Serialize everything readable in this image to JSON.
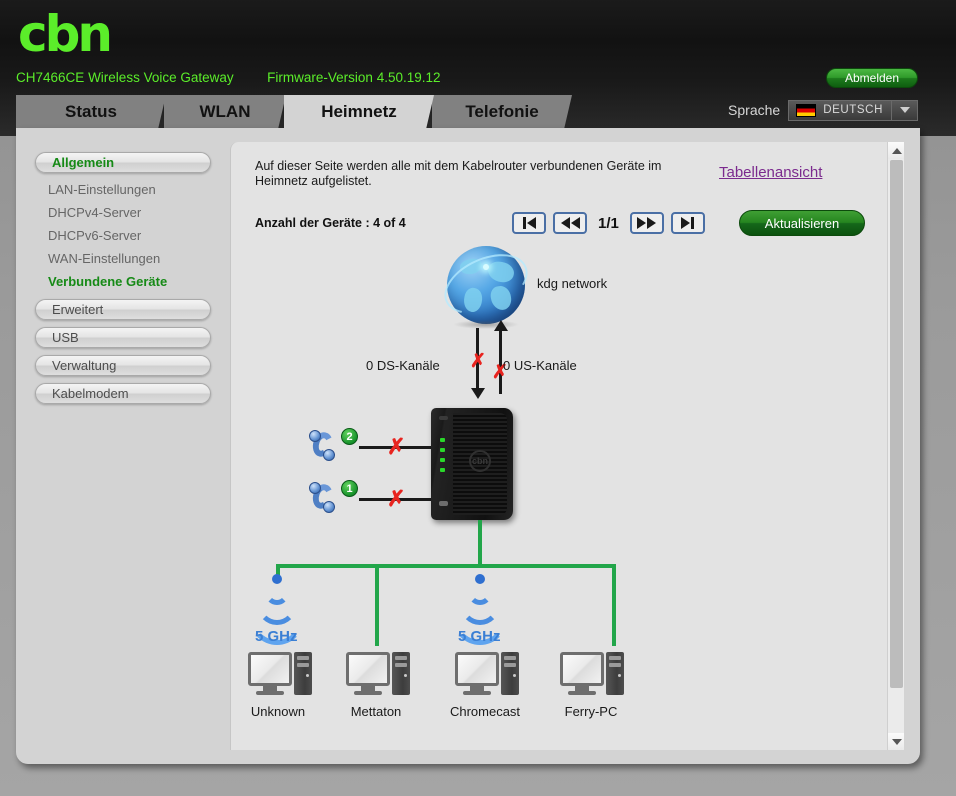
{
  "header": {
    "logo": "cbn",
    "model": "CH7466CE",
    "product": "Wireless Voice Gateway",
    "firmware_label": "Firmware-Version",
    "firmware_version": "4.50.19.12",
    "logout_label": "Abmelden",
    "language_label": "Sprache",
    "language_value": "DEUTSCH",
    "language_flag": "de-flag-icon"
  },
  "tabs": [
    {
      "label": "Status",
      "active": false
    },
    {
      "label": "WLAN",
      "active": false
    },
    {
      "label": "Heimnetz",
      "active": true
    },
    {
      "label": "Telefonie",
      "active": false
    }
  ],
  "sidebar": {
    "groups": [
      {
        "label": "Allgemein",
        "type": "button",
        "selected": true
      },
      {
        "label": "LAN-Einstellungen",
        "type": "sub",
        "selected": false
      },
      {
        "label": "DHCPv4-Server",
        "type": "sub",
        "selected": false
      },
      {
        "label": "DHCPv6-Server",
        "type": "sub",
        "selected": false
      },
      {
        "label": "WAN-Einstellungen",
        "type": "sub",
        "selected": false
      },
      {
        "label": "Verbundene Geräte",
        "type": "sub",
        "selected": true
      },
      {
        "label": "Erweitert",
        "type": "button",
        "selected": false
      },
      {
        "label": "USB",
        "type": "button",
        "selected": false
      },
      {
        "label": "Verwaltung",
        "type": "button",
        "selected": false
      },
      {
        "label": "Kabelmodem",
        "type": "button",
        "selected": false
      }
    ]
  },
  "content": {
    "intro": "Auf dieser Seite werden alle mit dem Kabelrouter verbundenen Geräte im Heimnetz aufgelistet.",
    "table_view_link": "Tabellenansicht",
    "device_count_label": "Anzahl der Geräte : 4 of 4",
    "page_indicator": "1/1",
    "refresh_label": "Aktualisieren",
    "pager": {
      "first": "first-page-icon",
      "prev": "prev-page-icon",
      "next": "next-page-icon",
      "last": "last-page-icon"
    }
  },
  "diagram": {
    "wan_label": "kdg network",
    "downstream_label": "0 DS-Kanäle",
    "upstream_label": "0 US-Kanäle",
    "downstream_status": "disconnected",
    "upstream_status": "disconnected",
    "phones": [
      {
        "line": "2",
        "status": "disconnected"
      },
      {
        "line": "1",
        "status": "disconnected"
      }
    ],
    "wifi_band": "5 GHz",
    "devices": [
      {
        "name": "Unknown",
        "connection": "wifi"
      },
      {
        "name": "Mettaton",
        "connection": "ethernet"
      },
      {
        "name": "Chromecast",
        "connection": "wifi"
      },
      {
        "name": "Ferry-PC",
        "connection": "ethernet"
      }
    ]
  },
  "colors": {
    "brand_green": "#5bed2a",
    "link_purple": "#7b2a8e",
    "lan_green": "#22a64a",
    "error_red": "#e8241f",
    "wifi_blue": "#3b7fd4",
    "active_tab": "#d3d3d3",
    "inactive_tab": "#818181"
  }
}
